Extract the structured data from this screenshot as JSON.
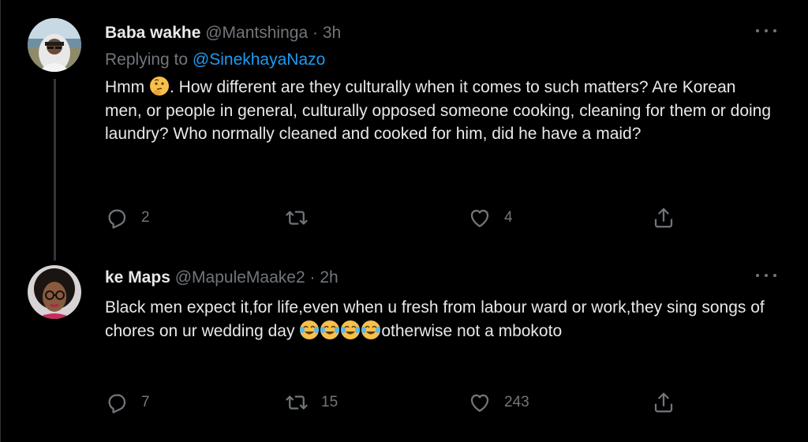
{
  "tweets": [
    {
      "display_name": "Baba wakhe",
      "handle": "@Mantshinga",
      "separator": "·",
      "time": "3h",
      "replying_prefix": "Replying to",
      "replying_to": "@SinekhayaNazo",
      "text_before_emoji": "Hmm ",
      "emoji": "thinking-face",
      "text_after_emoji": ". How different are they culturally when it comes to such matters? Are Korean men, or people in general, culturally opposed someone cooking, cleaning for them or doing laundry? Who normally cleaned and cooked for him, did he have a maid?",
      "reply_count": "2",
      "retweet_count": "",
      "like_count": "4"
    },
    {
      "display_name": "ke Maps",
      "handle": "@MapuleMaake2",
      "separator": "·",
      "time": "2h",
      "text_before_emoji": "Black men expect it,for life,even when u fresh from labour ward or work,they sing songs of chores on ur wedding day ",
      "emoji": "face-with-tears-of-joy x4",
      "text_after_emoji": "otherwise not a mbokoto",
      "reply_count": "7",
      "retweet_count": "15",
      "like_count": "243"
    }
  ],
  "icons": [
    "reply-icon",
    "retweet-icon",
    "like-icon",
    "share-icon",
    "more-icon"
  ],
  "colors": {
    "background": "#000000",
    "text": "#e7e9ea",
    "muted": "#71767b",
    "link": "#1d9bf0"
  }
}
